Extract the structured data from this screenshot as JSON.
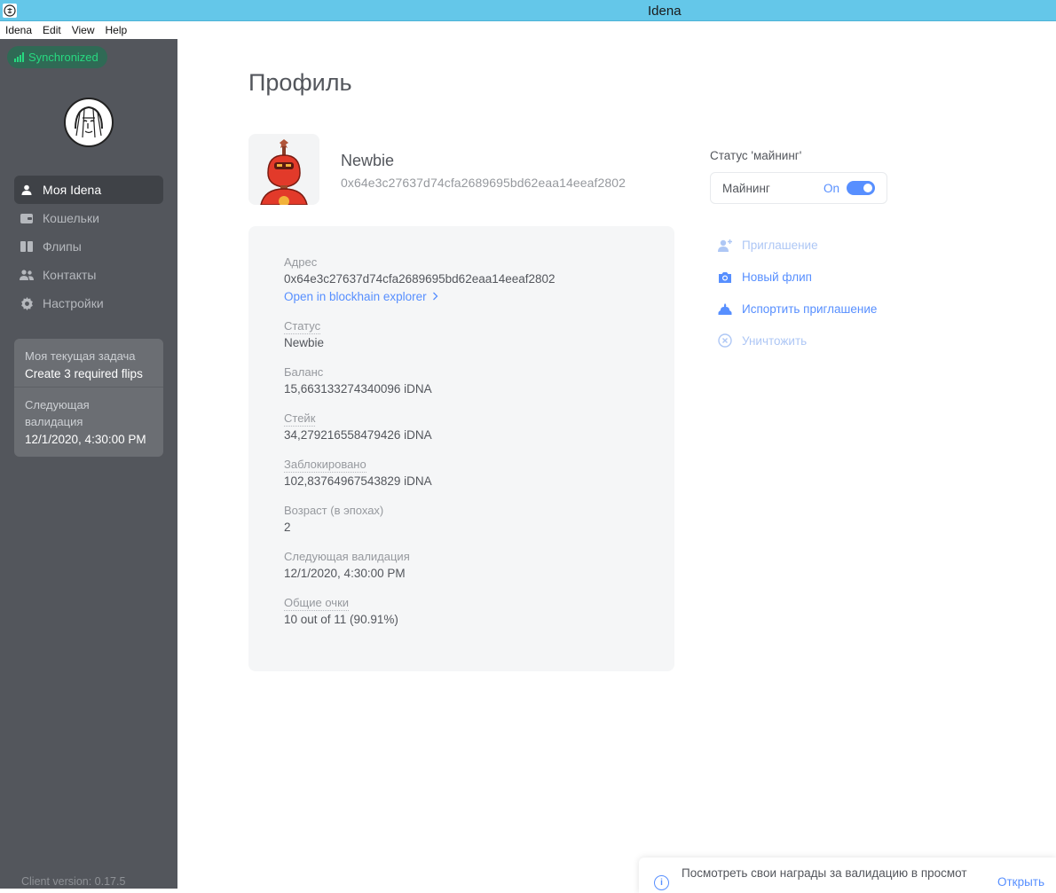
{
  "window": {
    "title": "Idena"
  },
  "menu": [
    "Idena",
    "Edit",
    "View",
    "Help"
  ],
  "sidebar": {
    "sync_label": "Synchronized",
    "nav": [
      {
        "label": "Моя Idena",
        "icon": "user-icon",
        "active": true
      },
      {
        "label": "Кошельки",
        "icon": "wallet-icon",
        "active": false
      },
      {
        "label": "Флипы",
        "icon": "flips-icon",
        "active": false
      },
      {
        "label": "Контакты",
        "icon": "contacts-icon",
        "active": false
      },
      {
        "label": "Настройки",
        "icon": "gear-icon",
        "active": false
      }
    ],
    "task": {
      "label": "Моя текущая задача",
      "value": "Create 3 required flips",
      "validation_label": "Следующая валидация",
      "validation_value": "12/1/2020, 4:30:00 PM"
    },
    "client_version": "Client version: 0.17.5"
  },
  "page": {
    "title": "Профиль"
  },
  "profile": {
    "name": "Newbie",
    "address": "0x64e3c27637d74cfa2689695bd62eaa14eeaf2802"
  },
  "details": {
    "address_label": "Адрес",
    "address_value": "0x64e3c27637d74cfa2689695bd62eaa14eeaf2802",
    "explorer_link": "Open in blockhain explorer",
    "status_label": "Статус",
    "status_value": "Newbie",
    "balance_label": "Баланс",
    "balance_value": "15,663133274340096 iDNA",
    "stake_label": "Стейк",
    "stake_value": "34,279216558479426 iDNA",
    "locked_label": "Заблокировано",
    "locked_value": "102,83764967543829 iDNA",
    "age_label": "Возраст (в эпохах)",
    "age_value": "2",
    "next_validation_label": "Следующая валидация",
    "next_validation_value": "12/1/2020, 4:30:00 PM",
    "score_label": "Общие очки",
    "score_value": "10 out of 11 (90.91%)"
  },
  "mining": {
    "label": "Статус 'майнинг'",
    "box_label": "Майнинг",
    "state": "On"
  },
  "actions": [
    {
      "label": "Приглашение",
      "icon": "add-user-icon",
      "disabled": true
    },
    {
      "label": "Новый флип",
      "icon": "camera-icon",
      "disabled": false
    },
    {
      "label": "Испортить приглашение",
      "icon": "poop-icon",
      "disabled": false
    },
    {
      "label": "Уничтожить",
      "icon": "cross-circle-icon",
      "disabled": true
    }
  ],
  "toast": {
    "message": "Посмотреть свои награды за валидацию в просмот",
    "action": "Открыть"
  },
  "colors": {
    "titlebar": "#64c7e9",
    "sidebar": "#53565c",
    "accent": "#578fff",
    "sync_green": "#27d980"
  }
}
